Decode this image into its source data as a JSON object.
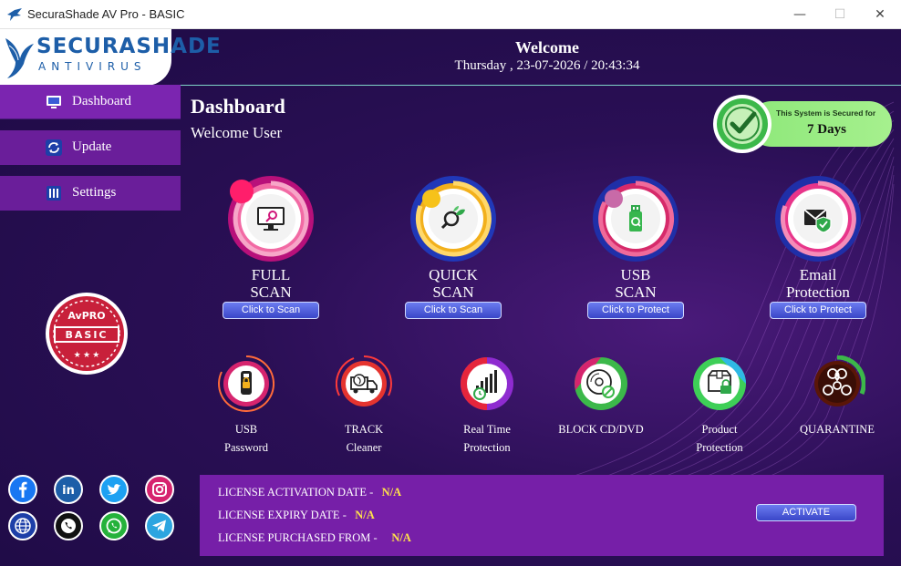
{
  "window": {
    "title": "SecuraShade AV Pro - BASIC",
    "controls": [
      "—",
      "☐",
      "✕"
    ]
  },
  "brand": {
    "line1": "SECURASHADE",
    "line2": "ANTIVIRUS"
  },
  "header": {
    "welcome": "Welcome",
    "datetime": "Thursday , 23-07-2026 / 20:43:34"
  },
  "sidebar": {
    "items": [
      {
        "label": "Dashboard",
        "icon": "monitor-icon"
      },
      {
        "label": "Update",
        "icon": "refresh-icon"
      },
      {
        "label": "Settings",
        "icon": "settings-icon"
      }
    ]
  },
  "badge": {
    "line1": "AvPRO",
    "line2": "BASIC"
  },
  "dashboard": {
    "title": "Dashboard",
    "subtitle": "Welcome User"
  },
  "secured": {
    "text": "This System is Secured for",
    "days": "7 Days"
  },
  "scans": [
    {
      "line1": "FULL",
      "line2": "SCAN",
      "button": "Click to Scan",
      "icon": "monitor-search-icon",
      "color": "#d0167a"
    },
    {
      "line1": "QUICK",
      "line2": "SCAN",
      "button": "Click to Scan",
      "icon": "magnifier-leaf-icon",
      "color": "#f2b01c"
    },
    {
      "line1": "USB",
      "line2": "SCAN",
      "button": "Click to Protect",
      "icon": "usb-drive-icon",
      "color": "#d62a6a"
    },
    {
      "line1": "Email",
      "line2": "Protection",
      "button": "Click to Protect",
      "icon": "email-shield-icon",
      "color": "#d61f6f"
    }
  ],
  "features": [
    {
      "line1": "USB",
      "line2": "Password",
      "icon": "usb-lock-icon"
    },
    {
      "line1": "TRACK",
      "line2": "Cleaner",
      "icon": "truck-cleaner-icon"
    },
    {
      "line1": "Real Time",
      "line2": "Protection",
      "icon": "realtime-chart-icon"
    },
    {
      "line1": "BLOCK CD/DVD",
      "line2": "",
      "icon": "disc-block-icon"
    },
    {
      "line1": "Product",
      "line2": "Protection",
      "icon": "box-lock-icon"
    },
    {
      "line1": "QUARANTINE",
      "line2": "",
      "icon": "biohazard-icon"
    }
  ],
  "license": {
    "activation_label": "LICENSE ACTIVATION DATE -",
    "activation_value": "N/A",
    "expiry_label": "LICENSE EXPIRY DATE -",
    "expiry_value": "N/A",
    "purchased_label": "LICENSE PURCHASED FROM -",
    "purchased_value": "N/A",
    "activate_button": "ACTIVATE"
  },
  "social": [
    "facebook-icon",
    "linkedin-icon",
    "twitter-icon",
    "instagram-icon",
    "website-icon",
    "phone-icon",
    "whatsapp-icon",
    "telegram-icon"
  ]
}
